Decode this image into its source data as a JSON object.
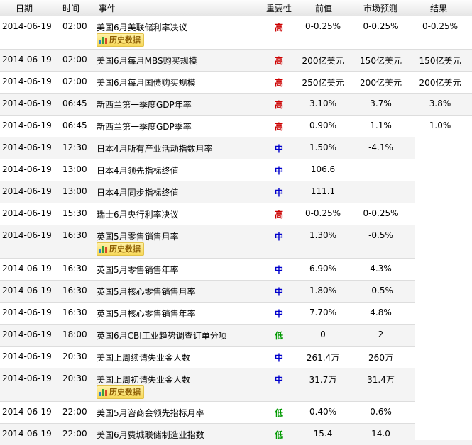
{
  "header": {
    "date": "日期",
    "time": "时间",
    "event": "事件",
    "importance": "重要性",
    "previous": "前值",
    "forecast": "市场预测",
    "actual": "结果"
  },
  "history_button_label": "历史数据",
  "importance_colors": {
    "high": "#cc0000",
    "mid": "#0000cc",
    "low": "#009900"
  },
  "rows": [
    {
      "date": "2014-06-19",
      "time": "02:00",
      "event": "美国6月美联储利率决议",
      "importance": "高",
      "previous": "0-0.25%",
      "forecast": "0-0.25%",
      "actual": "0-0.25%"
    },
    {
      "date": "2014-06-19",
      "time": "02:00",
      "event": "美国6月每月MBS购买规模",
      "importance": "高",
      "previous": "200亿美元",
      "forecast": "150亿美元",
      "actual": "150亿美元"
    },
    {
      "date": "2014-06-19",
      "time": "02:00",
      "event": "美国6月每月国债购买规模",
      "importance": "高",
      "previous": "250亿美元",
      "forecast": "200亿美元",
      "actual": "200亿美元"
    },
    {
      "date": "2014-06-19",
      "time": "06:45",
      "event": "新西兰第一季度GDP年率",
      "importance": "高",
      "previous": "3.10%",
      "forecast": "3.7%",
      "actual": "3.8%"
    },
    {
      "date": "2014-06-19",
      "time": "06:45",
      "event": "新西兰第一季度GDP季率",
      "importance": "高",
      "previous": "0.90%",
      "forecast": "1.1%",
      "actual": "1.0%"
    },
    {
      "date": "2014-06-19",
      "time": "12:30",
      "event": "日本4月所有产业活动指数月率",
      "importance": "中",
      "previous": "1.50%",
      "forecast": "-4.1%",
      "actual": ""
    },
    {
      "date": "2014-06-19",
      "time": "13:00",
      "event": "日本4月领先指标终值",
      "importance": "中",
      "previous": "106.6",
      "forecast": "",
      "actual": ""
    },
    {
      "date": "2014-06-19",
      "time": "13:00",
      "event": "日本4月同步指标终值",
      "importance": "中",
      "previous": "111.1",
      "forecast": "",
      "actual": ""
    },
    {
      "date": "2014-06-19",
      "time": "15:30",
      "event": "瑞士6月央行利率决议",
      "importance": "高",
      "previous": "0-0.25%",
      "forecast": "0-0.25%",
      "actual": ""
    },
    {
      "date": "2014-06-19",
      "time": "16:30",
      "event": "英国5月零售销售月率",
      "importance": "中",
      "previous": "1.30%",
      "forecast": "-0.5%",
      "actual": ""
    },
    {
      "date": "2014-06-19",
      "time": "16:30",
      "event": "英国5月零售销售年率",
      "importance": "中",
      "previous": "6.90%",
      "forecast": "4.3%",
      "actual": ""
    },
    {
      "date": "2014-06-19",
      "time": "16:30",
      "event": "英国5月核心零售销售月率",
      "importance": "中",
      "previous": "1.80%",
      "forecast": "-0.5%",
      "actual": ""
    },
    {
      "date": "2014-06-19",
      "time": "16:30",
      "event": "英国5月核心零售销售年率",
      "importance": "中",
      "previous": "7.70%",
      "forecast": "4.8%",
      "actual": ""
    },
    {
      "date": "2014-06-19",
      "time": "18:00",
      "event": "英国6月CBI工业趋势调查订单分项",
      "importance": "低",
      "previous": "0",
      "forecast": "2",
      "actual": ""
    },
    {
      "date": "2014-06-19",
      "time": "20:30",
      "event": "美国上周续请失业金人数",
      "importance": "中",
      "previous": "261.4万",
      "forecast": "260万",
      "actual": ""
    },
    {
      "date": "2014-06-19",
      "time": "20:30",
      "event": "美国上周初请失业金人数",
      "importance": "中",
      "previous": "31.7万",
      "forecast": "31.4万",
      "actual": ""
    },
    {
      "date": "2014-06-19",
      "time": "22:00",
      "event": "美国5月咨商会领先指标月率",
      "importance": "低",
      "previous": "0.40%",
      "forecast": "0.6%",
      "actual": ""
    },
    {
      "date": "2014-06-19",
      "time": "22:00",
      "event": "美国6月费城联储制造业指数",
      "importance": "低",
      "previous": "15.4",
      "forecast": "14.0",
      "actual": ""
    }
  ]
}
